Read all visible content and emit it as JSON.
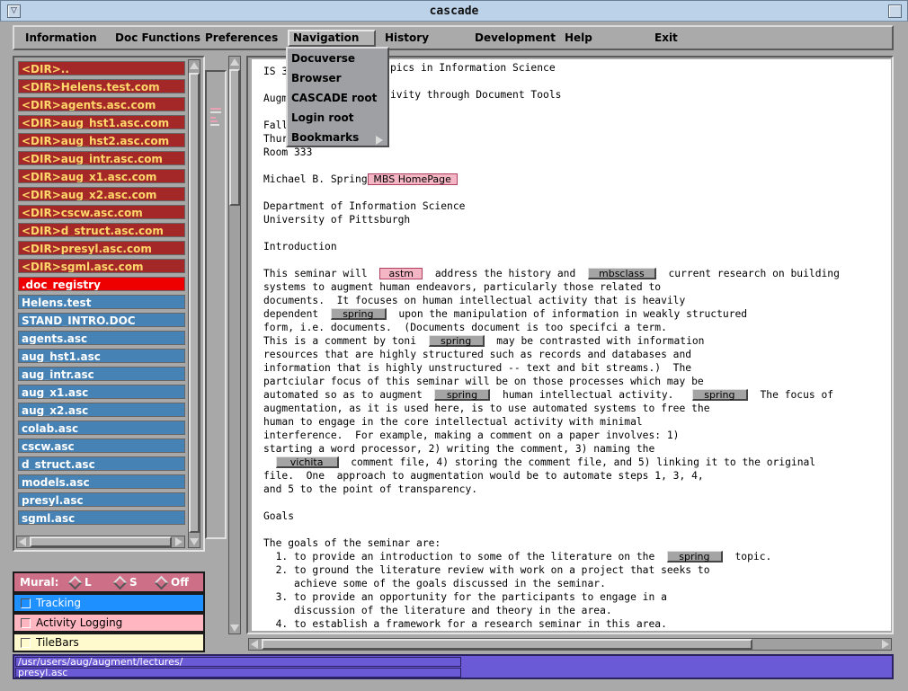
{
  "window": {
    "title": "cascade"
  },
  "menubar": {
    "items": [
      "Information",
      "Doc Functions",
      "Preferences",
      "Navigation",
      "History",
      "Development",
      "Help",
      "Exit"
    ],
    "active": "Navigation"
  },
  "navigation_menu": {
    "items": [
      "Docuverse",
      "Browser",
      "CASCADE root",
      "Login root",
      "Bookmarks"
    ]
  },
  "file_list": [
    {
      "label": "<DIR>..",
      "kind": "dir"
    },
    {
      "label": "<DIR>Helens.test.com",
      "kind": "dir"
    },
    {
      "label": "<DIR>agents.asc.com",
      "kind": "dir"
    },
    {
      "label": "<DIR>aug_hst1.asc.com",
      "kind": "dir"
    },
    {
      "label": "<DIR>aug_hst2.asc.com",
      "kind": "dir"
    },
    {
      "label": "<DIR>aug_intr.asc.com",
      "kind": "dir"
    },
    {
      "label": "<DIR>aug_x1.asc.com",
      "kind": "dir"
    },
    {
      "label": "<DIR>aug_x2.asc.com",
      "kind": "dir"
    },
    {
      "label": "<DIR>cscw.asc.com",
      "kind": "dir"
    },
    {
      "label": "<DIR>d_struct.asc.com",
      "kind": "dir"
    },
    {
      "label": "<DIR>presyl.asc.com",
      "kind": "dir"
    },
    {
      "label": "<DIR>sgml.asc.com",
      "kind": "dir"
    },
    {
      "label": ".doc_registry",
      "kind": "reg"
    },
    {
      "label": "Helens.test",
      "kind": "doc"
    },
    {
      "label": "STAND_INTRO.DOC",
      "kind": "doc"
    },
    {
      "label": "agents.asc",
      "kind": "doc"
    },
    {
      "label": "aug_hst1.asc",
      "kind": "doc"
    },
    {
      "label": "aug_intr.asc",
      "kind": "doc"
    },
    {
      "label": "aug_x1.asc",
      "kind": "doc"
    },
    {
      "label": "aug_x2.asc",
      "kind": "doc"
    },
    {
      "label": "colab.asc",
      "kind": "doc"
    },
    {
      "label": "cscw.asc",
      "kind": "doc"
    },
    {
      "label": "d_struct.asc",
      "kind": "doc"
    },
    {
      "label": "models.asc",
      "kind": "doc"
    },
    {
      "label": "presyl.asc",
      "kind": "doc"
    },
    {
      "label": "sgml.asc",
      "kind": "doc"
    }
  ],
  "mural": {
    "label": "Mural:",
    "options": [
      "L",
      "S",
      "Off"
    ],
    "colors": [
      "#e8a0b4",
      "#e0e0e0",
      "#e8a0b4",
      "#e8a0b4",
      "#e0e0e0",
      "#e8a0b4"
    ]
  },
  "toggles": {
    "tracking": "Tracking",
    "activity_logging": "Activity Logging",
    "tilebars": "TileBars"
  },
  "colors": {
    "tracking_bg": "#1e90ff",
    "activity_bg": "#ffb6c1",
    "tilebars_bg": "#fffacd",
    "status_bg": "#6a5ad5"
  },
  "document": {
    "lines": [
      [
        {
          "t": "IS 3"
        }
      ],
      [],
      [
        {
          "t": "Augm"
        }
      ],
      [],
      [
        {
          "t": "Fall"
        }
      ],
      [
        {
          "t": "Thur"
        }
      ],
      [
        {
          "t": "Room 333"
        }
      ],
      [],
      [
        {
          "t": "Michael B. Spring"
        },
        {
          "link": "MBS HomePage",
          "style": "pink",
          "w": 100
        }
      ],
      [],
      [
        {
          "t": "Department of Information Science"
        }
      ],
      [
        {
          "t": "University of Pittsburgh"
        }
      ],
      [],
      [
        {
          "t": "Introduction"
        }
      ],
      [],
      [
        {
          "t": "This seminar will  "
        },
        {
          "link": "astm",
          "style": "pink",
          "w": 48
        },
        {
          "t": "  address the history and  "
        },
        {
          "link": "mbsclass",
          "style": "grey",
          "w": 76
        },
        {
          "t": "  current research on building"
        }
      ],
      [
        {
          "t": "systems to augment human endeavors, particularly those related to"
        }
      ],
      [
        {
          "t": "documents.  It focuses on human intellectual activity that is heavily"
        }
      ],
      [
        {
          "t": "dependent  "
        },
        {
          "link": "spring",
          "style": "grey",
          "w": 62
        },
        {
          "t": "  upon the manipulation of information in weakly structured"
        }
      ],
      [
        {
          "t": "form, i.e. documents.  (Documents document is too specifci a term."
        }
      ],
      [
        {
          "t": "This is a comment by toni  "
        },
        {
          "link": "spring",
          "style": "grey",
          "w": 62
        },
        {
          "t": "  may be contrasted with information"
        }
      ],
      [
        {
          "t": "resources that are highly structured such as records and databases and"
        }
      ],
      [
        {
          "t": "information that is highly unstructured -- text and bit streams.)  The"
        }
      ],
      [
        {
          "t": "partciular focus of this seminar will be on those processes which may be"
        }
      ],
      [
        {
          "t": "automated so as to augment  "
        },
        {
          "link": "spring",
          "style": "grey",
          "w": 62
        },
        {
          "t": "  human intellectual activity.   "
        },
        {
          "link": "spring",
          "style": "grey",
          "w": 62
        },
        {
          "t": "  The focus of"
        }
      ],
      [
        {
          "t": "augmentation, as it is used here, is to use automated systems to free the"
        }
      ],
      [
        {
          "t": "human to engage in the core intellectual activity with minimal"
        }
      ],
      [
        {
          "t": "interference.  For example, making a comment on a paper involves: 1)"
        }
      ],
      [
        {
          "t": "starting a word processor, 2) writing the comment, 3) naming the"
        }
      ],
      [
        {
          "t": "  "
        },
        {
          "link": "vichita",
          "style": "grey",
          "w": 70
        },
        {
          "t": "  comment file, 4) storing the comment file, and 5) linking it to the original"
        }
      ],
      [
        {
          "t": "file.  One  approach to augmentation would be to automate steps 1, 3, 4,"
        }
      ],
      [
        {
          "t": "and 5 to the point of transparency."
        }
      ],
      [],
      [
        {
          "t": "Goals"
        }
      ],
      [],
      [
        {
          "t": "The goals of the seminar are:"
        }
      ],
      [
        {
          "t": "  1. to provide an introduction to some of the literature on the  "
        },
        {
          "link": "spring",
          "style": "grey",
          "w": 62
        },
        {
          "t": "  topic."
        }
      ],
      [
        {
          "t": "  2. to ground the literature review with work on a project that seeks to"
        }
      ],
      [
        {
          "t": "     achieve some of the goals discussed in the seminar."
        }
      ],
      [
        {
          "t": "  3. to provide an opportunity for the participants to engage in a"
        }
      ],
      [
        {
          "t": "     discussion of the literature and theory in the area."
        }
      ],
      [
        {
          "t": "  4. to establish a framework for a research seminar in this area."
        }
      ]
    ],
    "overlap_fragments": [
      "pics in Information Science",
      "ivity through Document Tools"
    ]
  },
  "status": {
    "path_line1": "/usr/users/aug/augment/lectures/",
    "path_line2": "presyl.asc"
  }
}
